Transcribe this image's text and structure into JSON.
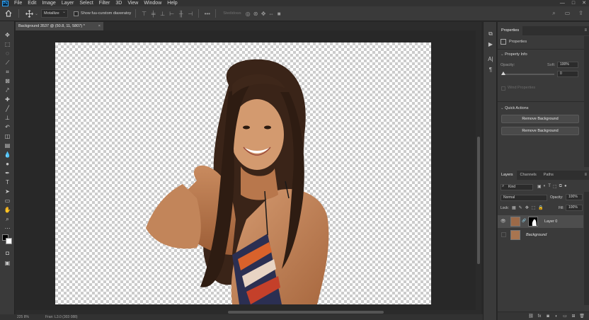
{
  "menubar": {
    "logo": "Ps",
    "items": [
      "File",
      "Edit",
      "Image",
      "Layer",
      "Select",
      "Filter",
      "3D",
      "View",
      "Window",
      "Help"
    ],
    "window_controls": [
      "—",
      "□",
      "✕"
    ]
  },
  "options": {
    "tool_select": "Motallize",
    "show_transform_label": "Show fuu-curstom diaxeratoy",
    "disabled_label": "Stedidows"
  },
  "document": {
    "tab_title": "Background 3537 @ (50.8, 11, 5807) *",
    "close": "×"
  },
  "statusbar": {
    "zoom": "225 8%",
    "info": "Fran: L3.0 (303 088)"
  },
  "properties": {
    "tab": "Properties",
    "header": "Properties",
    "property_info": "Property Info",
    "opacity_label": "Opacity:",
    "soft_label": "Soft:",
    "soft_value": "100%",
    "slider_value": "0",
    "wind_properties": "Wind Properties",
    "quick_actions": "Quick Actions",
    "remove_bg_1": "Remove Background",
    "remove_bg_2": "Remove Background"
  },
  "layers": {
    "tabs": [
      "Layers",
      "Channels",
      "Paths"
    ],
    "kind": "Kind",
    "blend_mode": "Normal",
    "opacity_label": "Opacity:",
    "opacity_value": "100%",
    "lock_label": "Lock:",
    "fill_label": "Fill:",
    "fill_value": "100%",
    "items": [
      {
        "name": "Layer 0",
        "selected": true,
        "visible": true
      },
      {
        "name": "Background",
        "selected": false,
        "visible": false
      }
    ]
  },
  "colors": {
    "ps_blue": "#31a8ff",
    "panel_bg": "#3a3a3a",
    "canvas_bg": "#282828"
  }
}
